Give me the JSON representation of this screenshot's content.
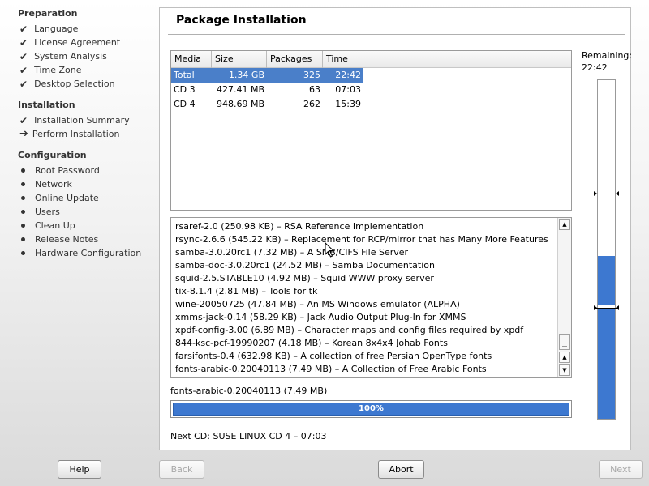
{
  "sidebar": {
    "sections": [
      {
        "title": "Preparation",
        "steps": [
          {
            "label": "Language",
            "state": "done"
          },
          {
            "label": "License Agreement",
            "state": "done"
          },
          {
            "label": "System Analysis",
            "state": "done"
          },
          {
            "label": "Time Zone",
            "state": "done"
          },
          {
            "label": "Desktop Selection",
            "state": "done"
          }
        ]
      },
      {
        "title": "Installation",
        "steps": [
          {
            "label": "Installation Summary",
            "state": "done"
          },
          {
            "label": "Perform Installation",
            "state": "current"
          }
        ]
      },
      {
        "title": "Configuration",
        "steps": [
          {
            "label": "Root Password",
            "state": "pending"
          },
          {
            "label": "Network",
            "state": "pending"
          },
          {
            "label": "Online Update",
            "state": "pending"
          },
          {
            "label": "Users",
            "state": "pending"
          },
          {
            "label": "Clean Up",
            "state": "pending"
          },
          {
            "label": "Release Notes",
            "state": "pending"
          },
          {
            "label": "Hardware Configuration",
            "state": "pending"
          }
        ]
      }
    ]
  },
  "main": {
    "title": "Package Installation",
    "table": {
      "headers": [
        "Media",
        "Size",
        "Packages",
        "Time"
      ],
      "rows": [
        {
          "media": "Total",
          "size": "1.34 GB",
          "packages": "325",
          "time": "22:42",
          "selected": true
        },
        {
          "media": "CD 3",
          "size": "427.41 MB",
          "packages": "63",
          "time": "07:03",
          "selected": false
        },
        {
          "media": "CD 4",
          "size": "948.69 MB",
          "packages": "262",
          "time": "15:39",
          "selected": false
        }
      ]
    },
    "log": [
      "rsaref-2.0 (250.98 KB) – RSA Reference Implementation",
      "rsync-2.6.6 (545.22 KB) – Replacement for RCP/mirror that has Many More Features",
      "samba-3.0.20rc1 (7.32 MB) – A SMB/CIFS File Server",
      "samba-doc-3.0.20rc1 (24.52 MB) – Samba Documentation",
      "squid-2.5.STABLE10 (4.92 MB) – Squid WWW proxy server",
      "tix-8.1.4 (2.81 MB) – Tools for tk",
      "wine-20050725 (47.84 MB) – An MS Windows emulator (ALPHA)",
      "xmms-jack-0.14 (58.29 KB) – Jack Audio Output Plug-In for XMMS",
      "xpdf-config-3.00 (6.89 MB) – Character maps and config files required by xpdf",
      "844-ksc-pcf-19990207 (4.18 MB) – Korean 8x4x4 Johab Fonts",
      "farsifonts-0.4 (632.98 KB) – A collection of free Persian OpenType fonts",
      "fonts-arabic-0.20040113 (7.49 MB) – A Collection of Free Arabic Fonts"
    ],
    "current_package": "fonts-arabic-0.20040113 (7.49 MB)",
    "progress_percent": 100,
    "progress_label": "100%",
    "next_cd": "Next CD: SUSE LINUX CD 4 – 07:03",
    "remaining": {
      "label": "Remaining:",
      "value": "22:42",
      "fill_fraction": 0.48
    }
  },
  "buttons": {
    "help": "Help",
    "back": "Back",
    "abort": "Abort",
    "next": "Next"
  },
  "colors": {
    "selection": "#4a7fc9",
    "progress": "#3d78d0"
  },
  "icons": {
    "done": "check-icon",
    "current": "arrow-right-icon",
    "pending": "bullet-icon"
  }
}
